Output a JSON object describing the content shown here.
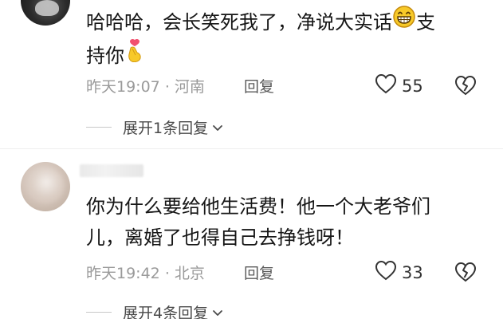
{
  "comments": [
    {
      "text_line1": "哈哈哈，会长笑死我了，净说大实话",
      "text_after_emoji": "支",
      "text_line2": "持你",
      "time": "昨天19:07",
      "separator": "·",
      "location": "河南",
      "reply_label": "回复",
      "likes": "55",
      "expand_label": "展开1条回复",
      "icons": [
        "grin-emoji-icon",
        "finger-heart-emoji-icon",
        "heart-outline-icon",
        "broken-heart-icon",
        "chevron-down-icon"
      ]
    },
    {
      "text_line1": "你为什么要给他生活费！他一个大老爷们",
      "text_line2": "儿，离婚了也得自己去挣钱呀！",
      "time": "昨天19:42",
      "separator": "·",
      "location": "北京",
      "reply_label": "回复",
      "likes": "33",
      "expand_label": "展开4条回复",
      "icons": [
        "heart-outline-icon",
        "broken-heart-icon",
        "chevron-down-icon"
      ]
    }
  ],
  "colors": {
    "text": "#161616",
    "meta": "#9a9a9a",
    "emoji_yellow": "#f7c928",
    "heart_pink": "#f2506e"
  }
}
